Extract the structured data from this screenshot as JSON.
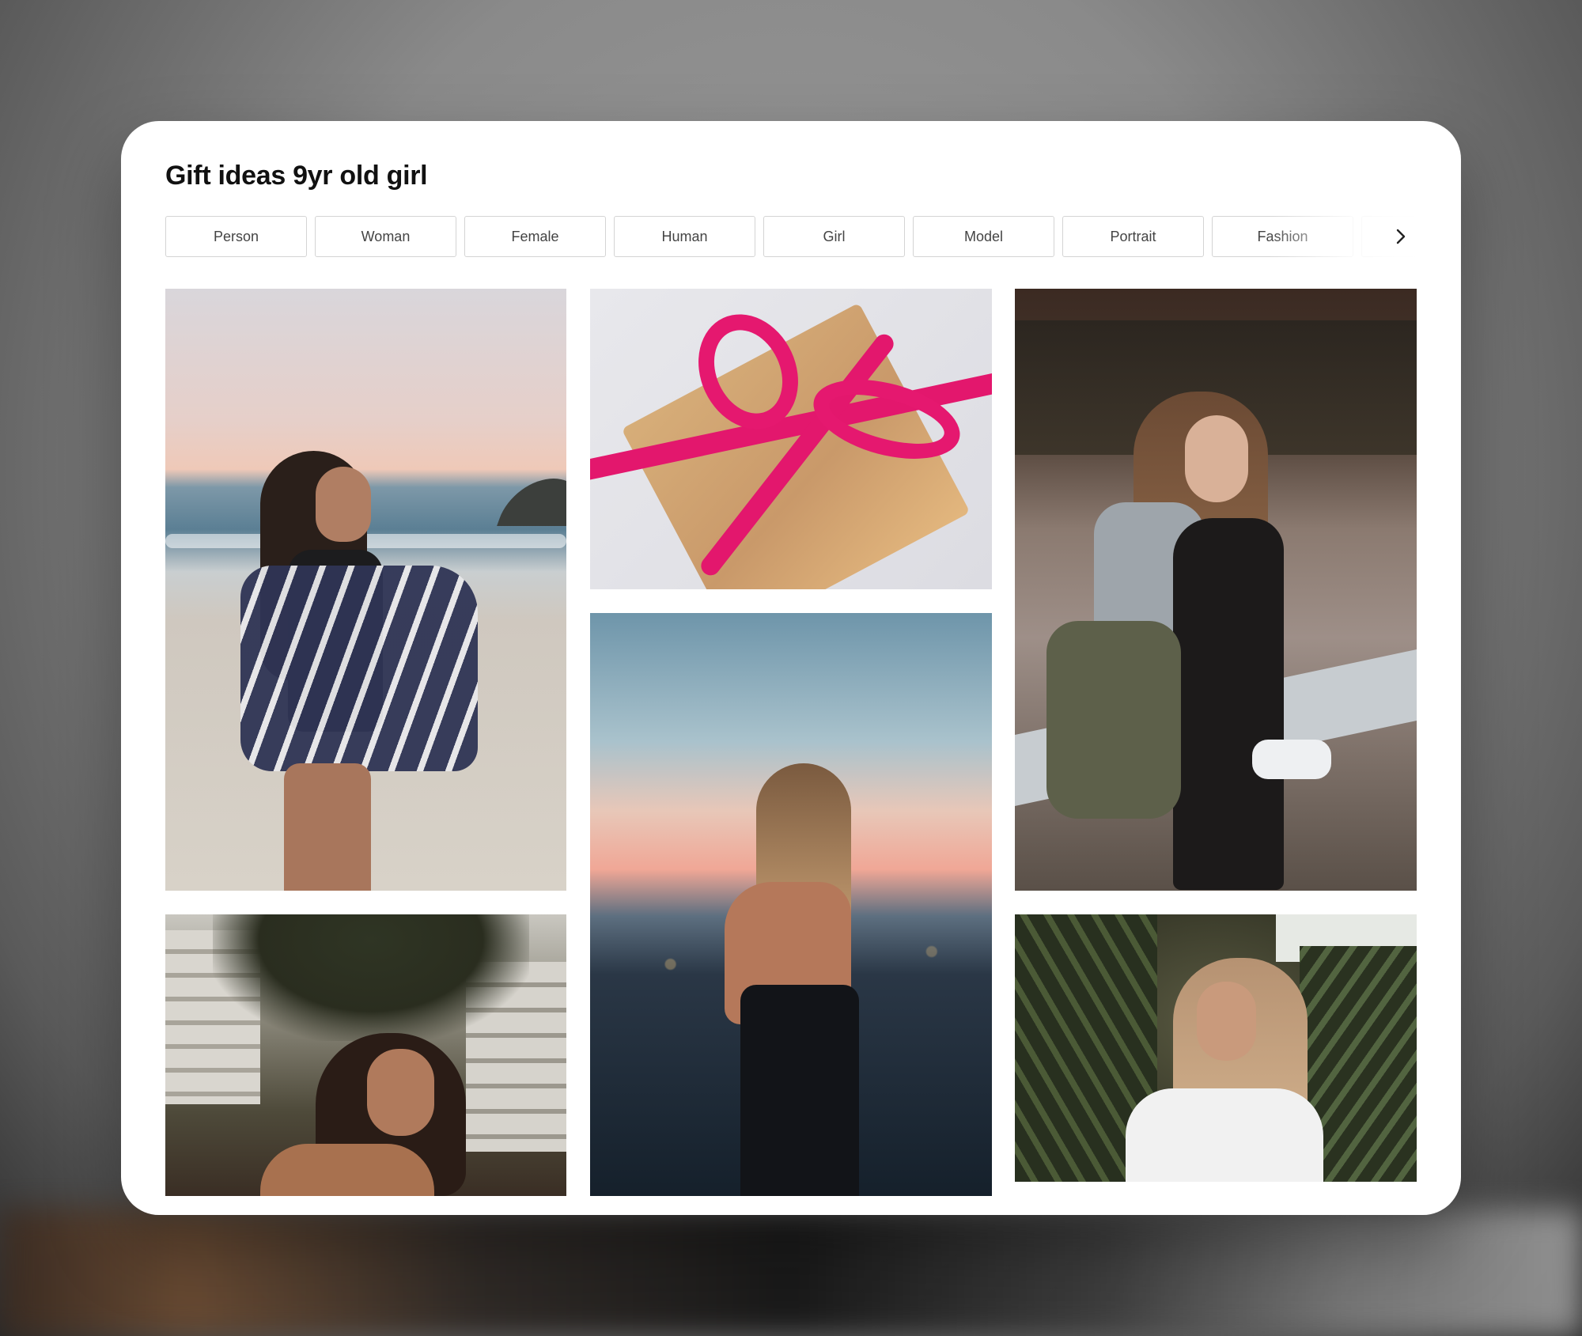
{
  "board": {
    "title": "Gift ideas 9yr old girl"
  },
  "tags": [
    "Person",
    "Woman",
    "Female",
    "Human",
    "Girl",
    "Model",
    "Portrait",
    "Fashion"
  ],
  "icons": {
    "next": "chevron-right-icon"
  },
  "photos": [
    {
      "name": "photo-beach-woman-towel",
      "subject": "woman with striped towel on beach"
    },
    {
      "name": "photo-gift-box-ribbon",
      "subject": "kraft gift box with pink ribbon"
    },
    {
      "name": "photo-woman-sitting-bench",
      "subject": "woman sitting on stone bench"
    },
    {
      "name": "photo-woman-palms",
      "subject": "woman among palm trees"
    },
    {
      "name": "photo-woman-sunset",
      "subject": "woman looking at sunset"
    },
    {
      "name": "photo-woman-plants",
      "subject": "woman in white top among plants"
    }
  ]
}
